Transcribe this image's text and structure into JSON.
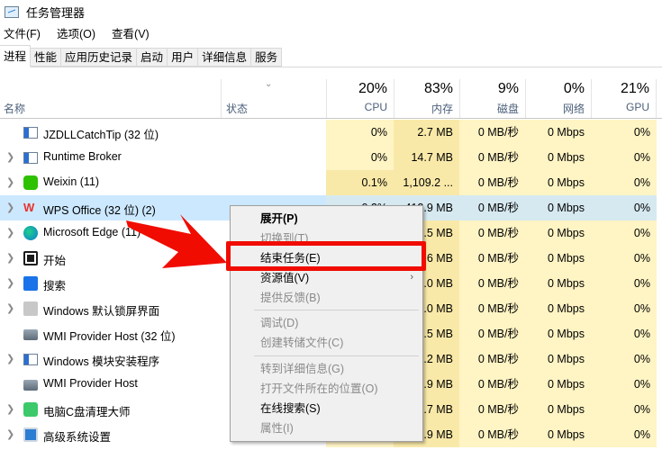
{
  "window": {
    "title": "任务管理器"
  },
  "menubar": [
    "文件(F)",
    "选项(O)",
    "查看(V)"
  ],
  "tabs": [
    "进程",
    "性能",
    "应用历史记录",
    "启动",
    "用户",
    "详细信息",
    "服务"
  ],
  "header": {
    "name": "名称",
    "status": "状态",
    "columns": [
      {
        "pct": "20%",
        "label": "CPU"
      },
      {
        "pct": "83%",
        "label": "内存"
      },
      {
        "pct": "9%",
        "label": "磁盘"
      },
      {
        "pct": "0%",
        "label": "网络"
      },
      {
        "pct": "21%",
        "label": "GPU"
      }
    ]
  },
  "rows": [
    {
      "name": "JZDLLCatchTip (32 位)",
      "icon": "app-window-icon",
      "expandable": false,
      "cpu": "0%",
      "mem": "2.7 MB",
      "disk": "0 MB/秒",
      "net": "0 Mbps",
      "gpu": "0%"
    },
    {
      "name": "Runtime Broker",
      "icon": "app-window-icon",
      "expandable": true,
      "cpu": "0%",
      "mem": "14.7 MB",
      "disk": "0 MB/秒",
      "net": "0 Mbps",
      "gpu": "0%"
    },
    {
      "name": "Weixin (11)",
      "icon": "wechat-icon",
      "expandable": true,
      "cpu": "0.1%",
      "mem": "1,109.2 ...",
      "disk": "0 MB/秒",
      "net": "0 Mbps",
      "gpu": "0%"
    },
    {
      "name": "WPS Office (32 位) (2)",
      "icon": "wps-icon",
      "expandable": true,
      "selected": true,
      "cpu": "0.2%",
      "mem": "412.9 MB",
      "disk": "0 MB/秒",
      "net": "0 Mbps",
      "gpu": "0%"
    },
    {
      "name": "Microsoft Edge (11)",
      "icon": "edge-icon",
      "expandable": true,
      "cpu": "",
      "mem": ".5 MB",
      "disk": "0 MB/秒",
      "net": "0 Mbps",
      "gpu": "0%"
    },
    {
      "name": "开始",
      "icon": "start-icon",
      "expandable": true,
      "cpu": "",
      "mem": ".6 MB",
      "disk": "0 MB/秒",
      "net": "0 Mbps",
      "gpu": "0%"
    },
    {
      "name": "搜索",
      "icon": "search-icon",
      "expandable": true,
      "cpu": "",
      "mem": ".0 MB",
      "disk": "0 MB/秒",
      "net": "0 Mbps",
      "gpu": "0%"
    },
    {
      "name": "Windows 默认锁屏界面",
      "icon": "lockscreen-icon",
      "expandable": true,
      "cpu": "",
      "mem": ".0 MB",
      "disk": "0 MB/秒",
      "net": "0 Mbps",
      "gpu": "0%"
    },
    {
      "name": "WMI Provider Host (32 位)",
      "icon": "wmi-icon",
      "expandable": false,
      "cpu": "",
      "mem": ".5 MB",
      "disk": "0 MB/秒",
      "net": "0 Mbps",
      "gpu": "0%"
    },
    {
      "name": "Windows 模块安装程序",
      "icon": "app-window-icon",
      "expandable": true,
      "cpu": "",
      "mem": ".2 MB",
      "disk": "0 MB/秒",
      "net": "0 Mbps",
      "gpu": "0%"
    },
    {
      "name": "WMI Provider Host",
      "icon": "wmi-icon",
      "expandable": false,
      "cpu": "",
      "mem": ".9 MB",
      "disk": "0 MB/秒",
      "net": "0 Mbps",
      "gpu": "0%"
    },
    {
      "name": "电脑C盘清理大师",
      "icon": "cleaner-icon",
      "expandable": true,
      "cpu": "",
      "mem": ".7 MB",
      "disk": "0 MB/秒",
      "net": "0 Mbps",
      "gpu": "0%"
    },
    {
      "name": "高级系统设置",
      "icon": "system-settings-icon",
      "expandable": true,
      "cpu": "",
      "mem": ".9 MB",
      "disk": "0 MB/秒",
      "net": "0 Mbps",
      "gpu": "0%"
    }
  ],
  "context_menu": [
    {
      "label": "展开(P)",
      "style": "bold"
    },
    {
      "label": "切换到(T)",
      "style": "disabled"
    },
    {
      "label": "结束任务(E)",
      "style": "normal",
      "highlighted": true
    },
    {
      "label": "资源值(V)",
      "style": "normal",
      "submenu": true
    },
    {
      "label": "提供反馈(B)",
      "style": "disabled"
    },
    {
      "label": "调试(D)",
      "style": "disabled"
    },
    {
      "label": "创建转储文件(C)",
      "style": "disabled"
    },
    {
      "label": "转到详细信息(G)",
      "style": "disabled"
    },
    {
      "label": "打开文件所在的位置(O)",
      "style": "disabled"
    },
    {
      "label": "在线搜索(S)",
      "style": "normal"
    },
    {
      "label": "属性(I)",
      "style": "disabled"
    }
  ],
  "colors": {
    "highlight_box": "#f00c00",
    "selected_row": "#cce8ff",
    "heat_light": "#fff4c4",
    "heat_mid": "#f9e9a8"
  }
}
